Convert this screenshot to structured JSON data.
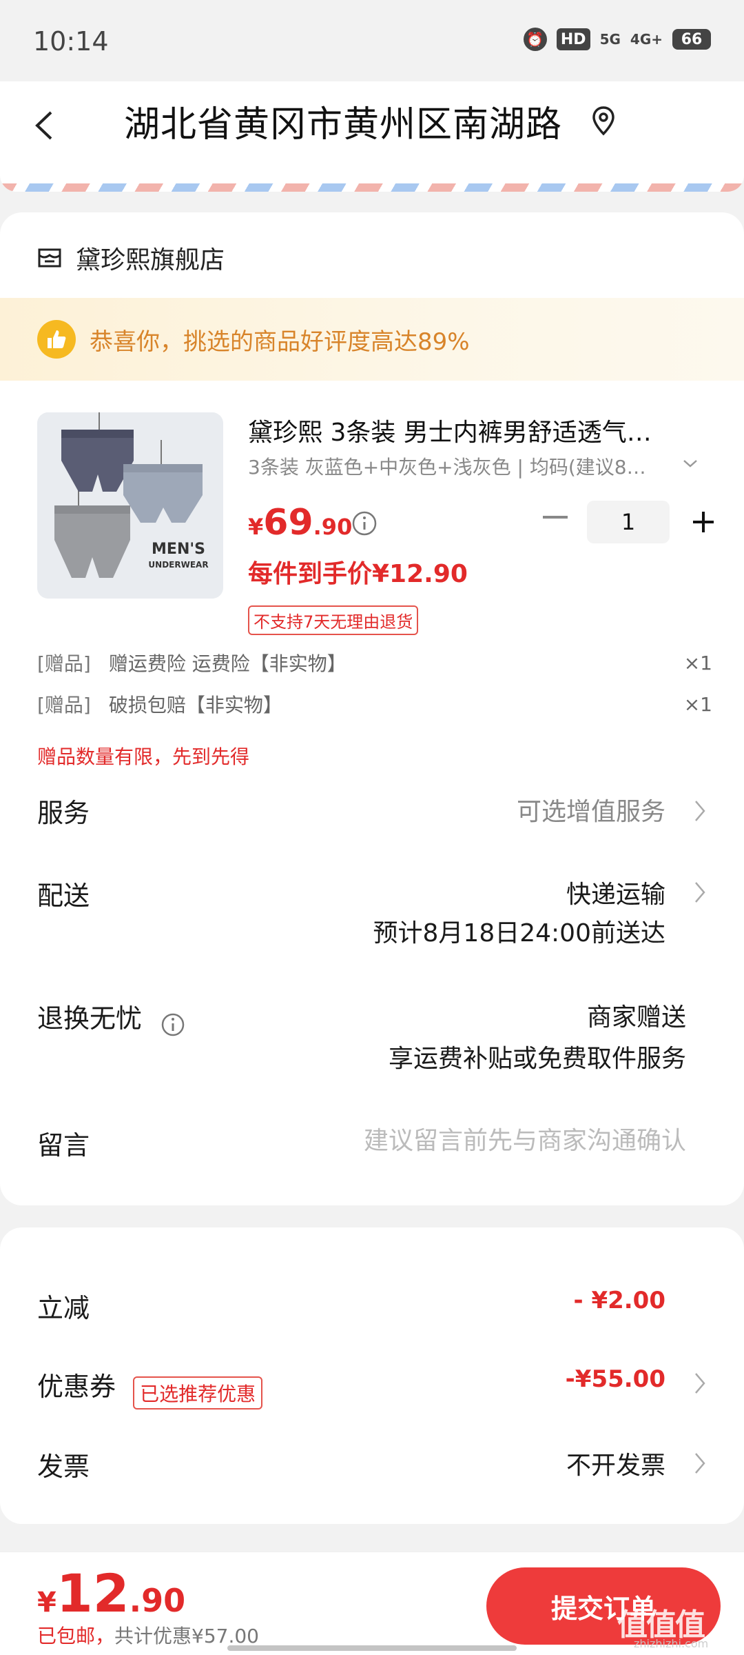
{
  "status_bar": {
    "time": "10:14",
    "network_1": "5G",
    "network_2": "4G+",
    "battery": "66"
  },
  "address": {
    "text": "湖北省黄冈市黄州区南湖路"
  },
  "shop": {
    "name": "黛珍熙旗舰店"
  },
  "rating_banner": {
    "text": "恭喜你，挑选的商品好评度高达89%"
  },
  "product": {
    "title": "黛珍熙 3条装 男士内裤男舒适透气…",
    "spec": "3条装 灰蓝色+中灰色+浅灰色 | 均码(建议8…",
    "price_currency": "¥",
    "price_int": "69",
    "price_dec": ".90",
    "quantity": "1",
    "unit_price": "每件到手价¥12.90",
    "return_tag": "不支持7天无理由退货",
    "image_caption_1": "MEN'S",
    "image_caption_2": "UNDERWEAR"
  },
  "gifts": [
    {
      "tag": "[赠品]",
      "name": "赠运费险 运费险【非实物】",
      "qty": "×1"
    },
    {
      "tag": "[赠品]",
      "name": "破损包赔【非实物】",
      "qty": "×1"
    }
  ],
  "gift_note": "赠品数量有限，先到先得",
  "service": {
    "label": "服务",
    "value": "可选增值服务"
  },
  "shipping": {
    "label": "配送",
    "value": "快递运输",
    "eta": "预计8月18日24:00前送达"
  },
  "returns": {
    "label": "退换无忧",
    "value": "商家赠送",
    "desc": "享运费补贴或免费取件服务"
  },
  "message": {
    "label": "留言",
    "placeholder": "建议留言前先与商家沟通确认"
  },
  "discount": {
    "label": "立减",
    "value": "- ¥2.00"
  },
  "coupon": {
    "label": "优惠券",
    "tag": "已选推荐优惠",
    "value": "-¥55.00"
  },
  "invoice": {
    "label": "发票",
    "value": "不开发票"
  },
  "bottom": {
    "currency": "¥",
    "total_int": "12",
    "total_dec": ".90",
    "shipping_free": "已包邮，",
    "saved": "共计优惠¥57.00",
    "submit_label": "提交订单"
  },
  "watermark": {
    "main": "值值值",
    "sub": "zhizhizhi.com"
  },
  "colors": {
    "accent_red": "#e22a2a",
    "button_red": "#ee3b3b",
    "banner_orange": "#d8842a"
  }
}
